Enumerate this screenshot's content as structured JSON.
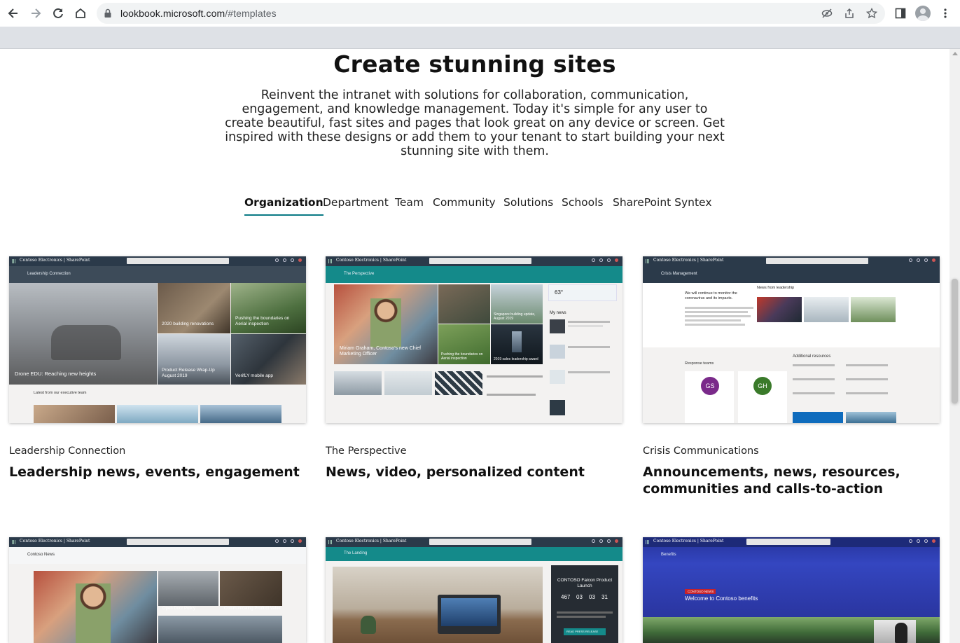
{
  "browser": {
    "url_host": "lookbook.microsoft.com",
    "url_path": "/#templates",
    "icons": [
      "back-icon",
      "forward-icon",
      "reload-icon",
      "home-icon",
      "lock-icon",
      "eye-off-icon",
      "share-icon",
      "star-icon",
      "sidebar-icon",
      "profile-icon",
      "menu-icon"
    ]
  },
  "hero": {
    "title": "Create stunning sites",
    "description": "Reinvent the intranet with solutions for collaboration, communication, engagement, and knowledge management. Today it's simple for any user to create beautiful, fast sites and pages that look great on any device or screen. Get inspired with these designs or add them to your tenant to start building your next stunning site with them."
  },
  "tabs": [
    {
      "label": "Organization",
      "active": true
    },
    {
      "label": "Department"
    },
    {
      "label": "Team"
    },
    {
      "label": "Community"
    },
    {
      "label": "Solutions"
    },
    {
      "label": "Schools"
    },
    {
      "label": "SharePoint Syntex"
    }
  ],
  "cards": [
    {
      "subtitle": "Leadership Connection",
      "headline": "Leadership news, events, engagement",
      "preview": {
        "brand": "Contoso Electronics",
        "app": "SharePoint",
        "site_name": "Leadership Connection",
        "captions": [
          "Drone EDU: Reaching new heights",
          "2020 building renovations",
          "Pushing the boundaries on Aerial inspection",
          "Product Release Wrap-Up August 2019",
          "VerifLY mobile app"
        ],
        "section": "Latest from our executive team"
      }
    },
    {
      "subtitle": "The Perspective",
      "headline": "News, video, personalized content",
      "preview": {
        "brand": "Contoso Electronics",
        "app": "SharePoint",
        "site_name": "The Perspective",
        "captions": [
          "Miriam Graham, Contoso's new Chief Marketing Officer",
          "Singapore building update, August 2019",
          "Pushing the boundaries on Aerial inspection",
          "2019 sales leadership award"
        ],
        "section": "My news",
        "weather": "63°"
      }
    },
    {
      "subtitle": "Crisis Communications",
      "headline": "Announcements, news, resources, communities and calls-to-action",
      "preview": {
        "brand": "Contoso Electronics",
        "app": "SharePoint",
        "site_name": "Crisis Management",
        "section": "News from leadership",
        "lead": "We will continue to monitor the coronavirus and its impacts.",
        "teams": "Response teams",
        "resources": "Additional resources",
        "initials": [
          "GS",
          "GH"
        ]
      }
    },
    {
      "preview": {
        "brand": "Contoso Electronics",
        "app": "SharePoint",
        "site_name": "Contoso News",
        "captions": [
          "Open Door Policy",
          "Communicating Product Value"
        ]
      }
    },
    {
      "preview": {
        "brand": "Contoso Electronics",
        "app": "SharePoint",
        "site_name": "The Landing",
        "promo": "CONTOSO Falcon Product Launch",
        "countdown": [
          "467",
          "03",
          "03",
          "31"
        ],
        "button": "READ PRESS RELEASE"
      }
    },
    {
      "preview": {
        "brand": "Contoso Electronics",
        "app": "SharePoint",
        "site_name": "Benefits",
        "tag": "CONTOSO NEWS",
        "banner": "Welcome to Contoso benefits"
      }
    }
  ],
  "colors": {
    "tab_underline": "#0a7a85",
    "sp_header": "#2b3a4a",
    "perspective_teal": "#148a8a",
    "crisis_purple": "#7a2a8a",
    "crisis_green": "#3a7a2a",
    "benefits_blue": "#2f3fb0"
  }
}
